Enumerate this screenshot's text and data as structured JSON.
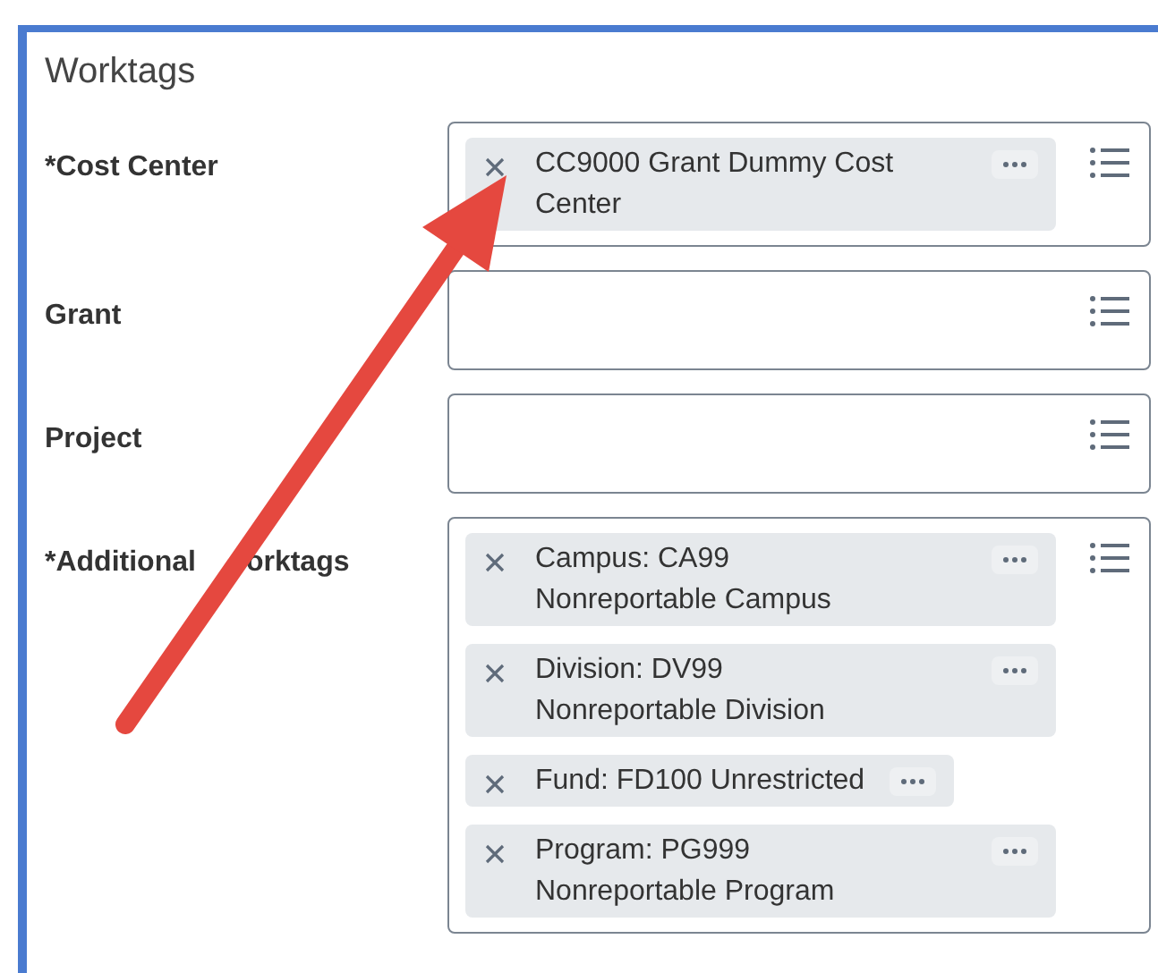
{
  "section": {
    "title": "Worktags"
  },
  "fields": [
    {
      "label": "*Cost Center",
      "chips": [
        {
          "lines": [
            "CC9000 Grant Dummy Cost",
            "Center"
          ]
        }
      ]
    },
    {
      "label": "Grant"
    },
    {
      "label": "Project"
    },
    {
      "label": "*Additional",
      "label_rest": "orktags",
      "chips": [
        {
          "lines": [
            "Campus: CA99",
            "Nonreportable Campus"
          ]
        },
        {
          "lines": [
            "Division: DV99",
            "Nonreportable Division"
          ]
        },
        {
          "lines": [
            "Fund: FD100 Unrestricted"
          ]
        },
        {
          "lines": [
            "Program: PG999",
            "Nonreportable Program"
          ]
        }
      ]
    }
  ]
}
